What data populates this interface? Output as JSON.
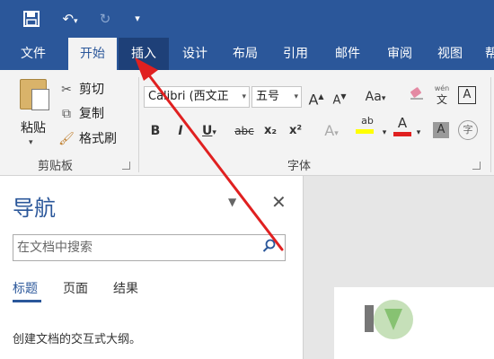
{
  "quick_access": {
    "save_icon": "save-icon",
    "undo_icon": "undo-icon",
    "redo_icon": "redo-icon",
    "more_icon": "customize-qat-icon"
  },
  "tabs": [
    {
      "label": "文件"
    },
    {
      "label": "开始"
    },
    {
      "label": "插入"
    },
    {
      "label": "设计"
    },
    {
      "label": "布局"
    },
    {
      "label": "引用"
    },
    {
      "label": "邮件"
    },
    {
      "label": "审阅"
    },
    {
      "label": "视图"
    },
    {
      "label": "帮"
    }
  ],
  "active_tab": "开始",
  "ribbon": {
    "clipboard": {
      "paste_label": "粘贴",
      "cut_label": "剪切",
      "copy_label": "复制",
      "format_painter_label": "格式刷",
      "group_label": "剪贴板"
    },
    "font": {
      "font_name": "Calibri (西文正",
      "font_size": "五号",
      "grow": "A",
      "shrink": "A",
      "case": "Aa",
      "clear_format": "clear-formatting-icon",
      "phonetic_small": "wén",
      "phonetic": "文",
      "border_char": "A",
      "bold": "B",
      "italic": "I",
      "underline": "U",
      "strike": "abc",
      "subscript": "x₂",
      "superscript": "x²",
      "text_effects": "A",
      "highlight": "ab",
      "font_color": "A",
      "shading_char": "A",
      "enclose_char": "字",
      "group_label": "字体"
    }
  },
  "navigation": {
    "title": "导航",
    "search_placeholder": "在文档中搜索",
    "tabs": [
      "标题",
      "页面",
      "结果"
    ],
    "description": "创建文档的交互式大纲。"
  },
  "colors": {
    "brand": "#2b579a",
    "arrow": "#e02020",
    "highlight": "#ffff00",
    "font_color": "#e02020"
  }
}
